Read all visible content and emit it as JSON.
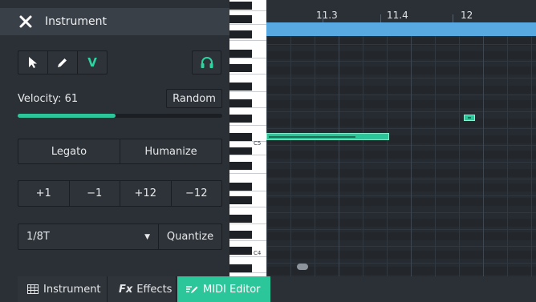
{
  "panel": {
    "title": "Instrument",
    "tools": {
      "v_label": "V"
    },
    "velocity": {
      "label": "Velocity: 61",
      "value": 61,
      "max": 127,
      "fraction": 0.48
    },
    "random_label": "Random",
    "legato_label": "Legato",
    "humanize_label": "Humanize",
    "transpose": [
      "+1",
      "−1",
      "+12",
      "−12"
    ],
    "grid_value": "1/8T",
    "quantize_label": "Quantize"
  },
  "tabs": [
    {
      "label": "Instrument",
      "icon": "grid-icon"
    },
    {
      "label": "Effects",
      "prefix": "Fx",
      "icon": "fx-icon"
    },
    {
      "label": "MIDI Editor",
      "icon": "midi-pen-icon",
      "active": true
    }
  ],
  "timeline": {
    "labels": [
      "11.3",
      "11.4",
      "12"
    ]
  },
  "piano": {
    "labels": [
      "C5",
      "C4"
    ]
  },
  "colors": {
    "accent": "#2bc79a",
    "loop_region": "#58a8e2",
    "panel_bg": "#2b3036",
    "grid_bg": "#262b31"
  }
}
